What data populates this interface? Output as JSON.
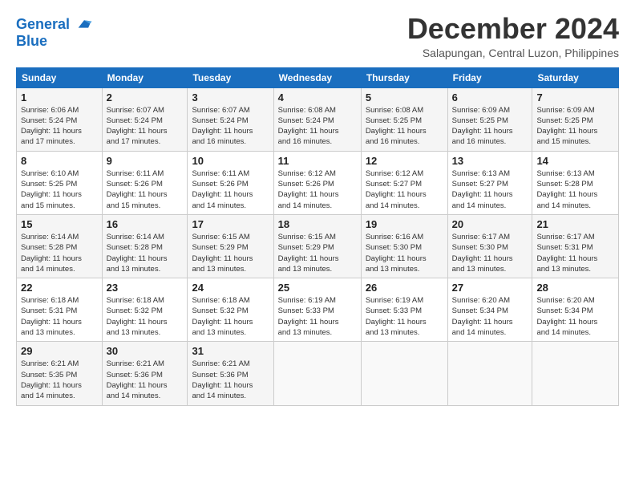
{
  "logo": {
    "line1": "General",
    "line2": "Blue"
  },
  "title": "December 2024",
  "subtitle": "Salapungan, Central Luzon, Philippines",
  "headers": [
    "Sunday",
    "Monday",
    "Tuesday",
    "Wednesday",
    "Thursday",
    "Friday",
    "Saturday"
  ],
  "weeks": [
    [
      {
        "day": "1",
        "info": "Sunrise: 6:06 AM\nSunset: 5:24 PM\nDaylight: 11 hours\nand 17 minutes."
      },
      {
        "day": "2",
        "info": "Sunrise: 6:07 AM\nSunset: 5:24 PM\nDaylight: 11 hours\nand 17 minutes."
      },
      {
        "day": "3",
        "info": "Sunrise: 6:07 AM\nSunset: 5:24 PM\nDaylight: 11 hours\nand 16 minutes."
      },
      {
        "day": "4",
        "info": "Sunrise: 6:08 AM\nSunset: 5:24 PM\nDaylight: 11 hours\nand 16 minutes."
      },
      {
        "day": "5",
        "info": "Sunrise: 6:08 AM\nSunset: 5:25 PM\nDaylight: 11 hours\nand 16 minutes."
      },
      {
        "day": "6",
        "info": "Sunrise: 6:09 AM\nSunset: 5:25 PM\nDaylight: 11 hours\nand 16 minutes."
      },
      {
        "day": "7",
        "info": "Sunrise: 6:09 AM\nSunset: 5:25 PM\nDaylight: 11 hours\nand 15 minutes."
      }
    ],
    [
      {
        "day": "8",
        "info": "Sunrise: 6:10 AM\nSunset: 5:25 PM\nDaylight: 11 hours\nand 15 minutes."
      },
      {
        "day": "9",
        "info": "Sunrise: 6:11 AM\nSunset: 5:26 PM\nDaylight: 11 hours\nand 15 minutes."
      },
      {
        "day": "10",
        "info": "Sunrise: 6:11 AM\nSunset: 5:26 PM\nDaylight: 11 hours\nand 14 minutes."
      },
      {
        "day": "11",
        "info": "Sunrise: 6:12 AM\nSunset: 5:26 PM\nDaylight: 11 hours\nand 14 minutes."
      },
      {
        "day": "12",
        "info": "Sunrise: 6:12 AM\nSunset: 5:27 PM\nDaylight: 11 hours\nand 14 minutes."
      },
      {
        "day": "13",
        "info": "Sunrise: 6:13 AM\nSunset: 5:27 PM\nDaylight: 11 hours\nand 14 minutes."
      },
      {
        "day": "14",
        "info": "Sunrise: 6:13 AM\nSunset: 5:28 PM\nDaylight: 11 hours\nand 14 minutes."
      }
    ],
    [
      {
        "day": "15",
        "info": "Sunrise: 6:14 AM\nSunset: 5:28 PM\nDaylight: 11 hours\nand 14 minutes."
      },
      {
        "day": "16",
        "info": "Sunrise: 6:14 AM\nSunset: 5:28 PM\nDaylight: 11 hours\nand 13 minutes."
      },
      {
        "day": "17",
        "info": "Sunrise: 6:15 AM\nSunset: 5:29 PM\nDaylight: 11 hours\nand 13 minutes."
      },
      {
        "day": "18",
        "info": "Sunrise: 6:15 AM\nSunset: 5:29 PM\nDaylight: 11 hours\nand 13 minutes."
      },
      {
        "day": "19",
        "info": "Sunrise: 6:16 AM\nSunset: 5:30 PM\nDaylight: 11 hours\nand 13 minutes."
      },
      {
        "day": "20",
        "info": "Sunrise: 6:17 AM\nSunset: 5:30 PM\nDaylight: 11 hours\nand 13 minutes."
      },
      {
        "day": "21",
        "info": "Sunrise: 6:17 AM\nSunset: 5:31 PM\nDaylight: 11 hours\nand 13 minutes."
      }
    ],
    [
      {
        "day": "22",
        "info": "Sunrise: 6:18 AM\nSunset: 5:31 PM\nDaylight: 11 hours\nand 13 minutes."
      },
      {
        "day": "23",
        "info": "Sunrise: 6:18 AM\nSunset: 5:32 PM\nDaylight: 11 hours\nand 13 minutes."
      },
      {
        "day": "24",
        "info": "Sunrise: 6:18 AM\nSunset: 5:32 PM\nDaylight: 11 hours\nand 13 minutes."
      },
      {
        "day": "25",
        "info": "Sunrise: 6:19 AM\nSunset: 5:33 PM\nDaylight: 11 hours\nand 13 minutes."
      },
      {
        "day": "26",
        "info": "Sunrise: 6:19 AM\nSunset: 5:33 PM\nDaylight: 11 hours\nand 13 minutes."
      },
      {
        "day": "27",
        "info": "Sunrise: 6:20 AM\nSunset: 5:34 PM\nDaylight: 11 hours\nand 14 minutes."
      },
      {
        "day": "28",
        "info": "Sunrise: 6:20 AM\nSunset: 5:34 PM\nDaylight: 11 hours\nand 14 minutes."
      }
    ],
    [
      {
        "day": "29",
        "info": "Sunrise: 6:21 AM\nSunset: 5:35 PM\nDaylight: 11 hours\nand 14 minutes."
      },
      {
        "day": "30",
        "info": "Sunrise: 6:21 AM\nSunset: 5:36 PM\nDaylight: 11 hours\nand 14 minutes."
      },
      {
        "day": "31",
        "info": "Sunrise: 6:21 AM\nSunset: 5:36 PM\nDaylight: 11 hours\nand 14 minutes."
      },
      {
        "day": "",
        "info": ""
      },
      {
        "day": "",
        "info": ""
      },
      {
        "day": "",
        "info": ""
      },
      {
        "day": "",
        "info": ""
      }
    ]
  ]
}
